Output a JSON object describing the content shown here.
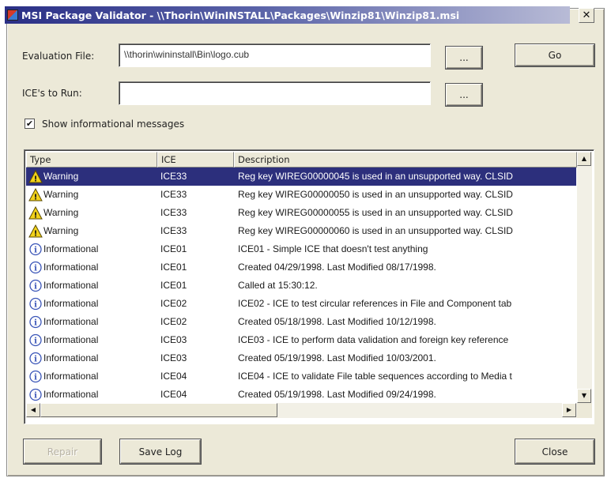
{
  "window": {
    "title": "MSI Package Validator - \\\\Thorin\\WinINSTALL\\Packages\\Winzip81\\Winzip81.msi",
    "close_glyph": "✕"
  },
  "form": {
    "evaluation_label": "Evaluation File:",
    "evaluation_value": "\\\\thorin\\wininstall\\Bin\\logo.cub",
    "ices_label": "ICE's to Run:",
    "ices_value": "",
    "browse_label": "...",
    "go_label": "Go",
    "show_info_label": "Show informational messages",
    "show_info_checked": true,
    "check_glyph": "✔"
  },
  "table": {
    "columns": [
      "Type",
      "ICE",
      "Description"
    ],
    "rows": [
      {
        "type": "Warning",
        "icon": "warning-icon",
        "ice": "ICE33",
        "description": "Reg key WIREG00000045 is used in an unsupported way. CLSID",
        "selected": true
      },
      {
        "type": "Warning",
        "icon": "warning-icon",
        "ice": "ICE33",
        "description": "Reg key WIREG00000050 is used in an unsupported way. CLSID"
      },
      {
        "type": "Warning",
        "icon": "warning-icon",
        "ice": "ICE33",
        "description": "Reg key WIREG00000055 is used in an unsupported way. CLSID"
      },
      {
        "type": "Warning",
        "icon": "warning-icon",
        "ice": "ICE33",
        "description": "Reg key WIREG00000060 is used in an unsupported way. CLSID"
      },
      {
        "type": "Informational",
        "icon": "info-icon",
        "ice": "ICE01",
        "description": "ICE01 - Simple ICE that doesn't test anything"
      },
      {
        "type": "Informational",
        "icon": "info-icon",
        "ice": "ICE01",
        "description": "Created 04/29/1998. Last Modified 08/17/1998."
      },
      {
        "type": "Informational",
        "icon": "info-icon",
        "ice": "ICE01",
        "description": "Called at 15:30:12."
      },
      {
        "type": "Informational",
        "icon": "info-icon",
        "ice": "ICE02",
        "description": "ICE02 - ICE to test circular references in File and Component tab"
      },
      {
        "type": "Informational",
        "icon": "info-icon",
        "ice": "ICE02",
        "description": "Created 05/18/1998. Last Modified 10/12/1998."
      },
      {
        "type": "Informational",
        "icon": "info-icon",
        "ice": "ICE03",
        "description": "ICE03 - ICE to perform data validation and foreign key reference"
      },
      {
        "type": "Informational",
        "icon": "info-icon",
        "ice": "ICE03",
        "description": "Created 05/19/1998. Last Modified 10/03/2001."
      },
      {
        "type": "Informational",
        "icon": "info-icon",
        "ice": "ICE04",
        "description": "ICE04 - ICE to validate File table sequences according to Media t"
      },
      {
        "type": "Informational",
        "icon": "info-icon",
        "ice": "ICE04",
        "description": "Created 05/19/1998. Last Modified 09/24/1998."
      }
    ]
  },
  "scroll": {
    "up": "▲",
    "down": "▼",
    "left": "◀",
    "right": "▶"
  },
  "buttons": {
    "repair": "Repair",
    "save_log": "Save Log",
    "close": "Close"
  },
  "colors": {
    "selection": "#2c2f7c",
    "title_bar": "#2a2f86",
    "warning_fill": "#f2d21a",
    "info_fill": "#ffffff",
    "info_stroke": "#3b56b8"
  }
}
